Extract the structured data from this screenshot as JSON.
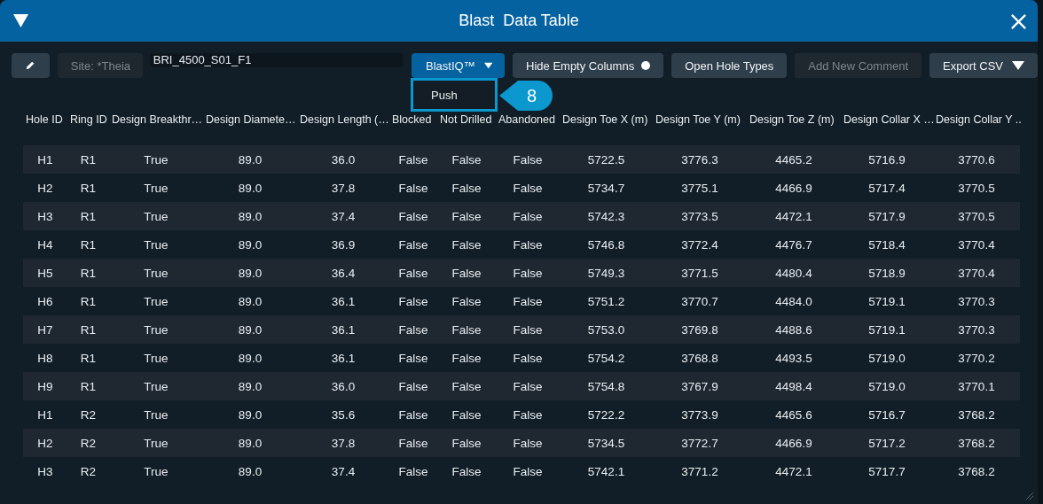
{
  "window": {
    "title": "Blast  Data Table"
  },
  "toolbar": [
    {
      "kind": "icon",
      "disabled": false
    },
    {
      "kind": "field",
      "label": "Site: *Theia",
      "disabled": true
    },
    {
      "kind": "input",
      "label": "BRI_4500_S01_F1",
      "disabled": false
    },
    {
      "kind": "dropdown",
      "label": "BlastIQ™",
      "disabled": false,
      "primary": true
    },
    {
      "kind": "toggle",
      "label": "Hide Empty Columns",
      "disabled": false
    },
    {
      "kind": "button",
      "label": "Open Hole Types",
      "disabled": false
    },
    {
      "kind": "button",
      "label": "Add New Comment",
      "disabled": true
    },
    {
      "kind": "dropdown",
      "label": "Export CSV",
      "disabled": false
    }
  ],
  "menu": {
    "items": [
      "Push"
    ],
    "callout": "8"
  },
  "table": {
    "columns": [
      "Hole ID",
      "Ring ID",
      "Design Breakthr…",
      "Design Diamete…",
      "Design Length (…",
      "Blocked",
      "Not Drilled",
      "Abandoned",
      "Design Toe X (m)",
      "Design Toe Y (m)",
      "Design Toe Z (m)",
      "Design Collar X …",
      "Design Collar Y .."
    ],
    "rows": [
      [
        "H1",
        "R1",
        "True",
        "89.0",
        "36.0",
        "False",
        "False",
        "False",
        "5722.5",
        "3776.3",
        "4465.2",
        "5716.9",
        "3770.6"
      ],
      [
        "H2",
        "R1",
        "True",
        "89.0",
        "37.8",
        "False",
        "False",
        "False",
        "5734.7",
        "3775.1",
        "4466.9",
        "5717.4",
        "3770.5"
      ],
      [
        "H3",
        "R1",
        "True",
        "89.0",
        "37.4",
        "False",
        "False",
        "False",
        "5742.3",
        "3773.5",
        "4472.1",
        "5717.9",
        "3770.5"
      ],
      [
        "H4",
        "R1",
        "True",
        "89.0",
        "36.9",
        "False",
        "False",
        "False",
        "5746.8",
        "3772.4",
        "4476.7",
        "5718.4",
        "3770.4"
      ],
      [
        "H5",
        "R1",
        "True",
        "89.0",
        "36.4",
        "False",
        "False",
        "False",
        "5749.3",
        "3771.5",
        "4480.4",
        "5718.9",
        "3770.4"
      ],
      [
        "H6",
        "R1",
        "True",
        "89.0",
        "36.1",
        "False",
        "False",
        "False",
        "5751.2",
        "3770.7",
        "4484.0",
        "5719.1",
        "3770.3"
      ],
      [
        "H7",
        "R1",
        "True",
        "89.0",
        "36.1",
        "False",
        "False",
        "False",
        "5753.0",
        "3769.8",
        "4488.6",
        "5719.1",
        "3770.3"
      ],
      [
        "H8",
        "R1",
        "True",
        "89.0",
        "36.1",
        "False",
        "False",
        "False",
        "5754.2",
        "3768.8",
        "4493.5",
        "5719.0",
        "3770.2"
      ],
      [
        "H9",
        "R1",
        "True",
        "89.0",
        "36.0",
        "False",
        "False",
        "False",
        "5754.8",
        "3767.9",
        "4498.4",
        "5719.0",
        "3770.1"
      ],
      [
        "H1",
        "R2",
        "True",
        "89.0",
        "35.6",
        "False",
        "False",
        "False",
        "5722.2",
        "3773.9",
        "4465.6",
        "5716.7",
        "3768.2"
      ],
      [
        "H2",
        "R2",
        "True",
        "89.0",
        "37.8",
        "False",
        "False",
        "False",
        "5734.5",
        "3772.7",
        "4466.9",
        "5717.2",
        "3768.2"
      ],
      [
        "H3",
        "R2",
        "True",
        "89.0",
        "37.4",
        "False",
        "False",
        "False",
        "5742.1",
        "3771.2",
        "4472.1",
        "5717.7",
        "3768.2"
      ]
    ]
  }
}
